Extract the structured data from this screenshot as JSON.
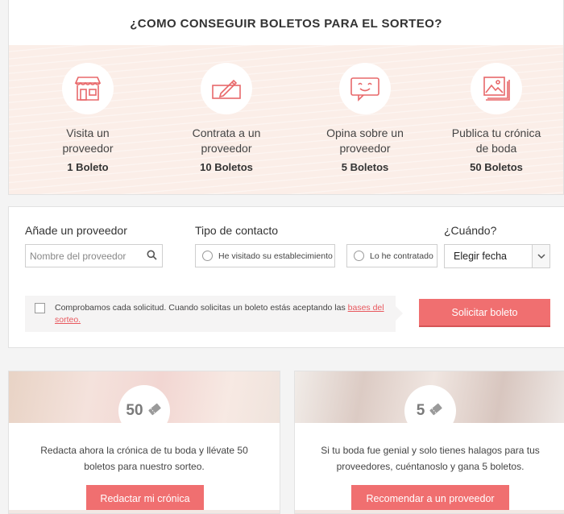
{
  "howto": {
    "title": "¿COMO CONSEGUIR BOLETOS PARA EL SORTEO?",
    "steps": [
      {
        "icon": "store-icon",
        "label_line1": "Visita un",
        "label_line2": "proveedor",
        "count": "1 Boleto"
      },
      {
        "icon": "contract-pen-icon",
        "label_line1": "Contrata a un",
        "label_line2": "proveedor",
        "count": "10 Boletos"
      },
      {
        "icon": "review-bubble-icon",
        "label_line1": "Opina sobre un",
        "label_line2": "proveedor",
        "count": "5 Boletos"
      },
      {
        "icon": "photo-gallery-icon",
        "label_line1": "Publica tu crónica",
        "label_line2": "de boda",
        "count": "50 Boletos"
      }
    ]
  },
  "form": {
    "provider_label": "Añade un proveedor",
    "provider_placeholder": "Nombre del proveedor",
    "contact_label": "Tipo de contacto",
    "contact_options": [
      "He visitado su establecimiento",
      "Lo he contratado"
    ],
    "when_label": "¿Cuándo?",
    "when_value": "Elegir fecha",
    "terms_text": "Comprobamos cada solicitud. Cuando solicitas un boleto estás aceptando las ",
    "terms_link": "bases del sorteo.",
    "submit_label": "Solicitar boleto"
  },
  "cards": [
    {
      "number": "50",
      "text": "Redacta ahora la crónica de tu boda y llévate 50 boletos para nuestro sorteo.",
      "button": "Redactar mi crónica"
    },
    {
      "number": "5",
      "text": "Si tu boda fue genial y solo tienes halagos para tus proveedores, cuéntanoslo y gana 5 boletos.",
      "button": "Recomendar a un proveedor"
    }
  ],
  "colors": {
    "accent": "#f06f70",
    "link": "#e8585e",
    "band": "#fbeee8",
    "icon": "#e8686a"
  }
}
